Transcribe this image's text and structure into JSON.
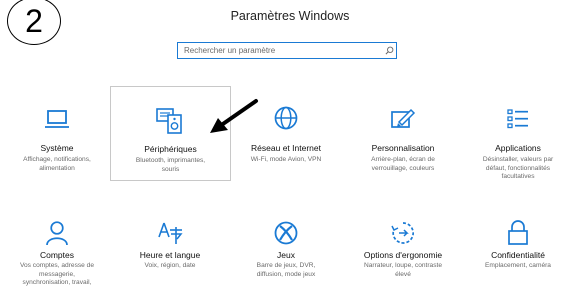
{
  "step_marker": "2",
  "window_title": "Paramètres Windows",
  "search": {
    "placeholder": "Rechercher un paramètre"
  },
  "accent_color": "#1a7ad4",
  "tiles_row1": [
    {
      "id": "systeme",
      "icon": "laptop-icon",
      "name": "Système",
      "description": "Affichage, notifications,\nalimentation"
    },
    {
      "id": "peripheriques",
      "icon": "devices-icon",
      "name": "Périphériques",
      "description": "Bluetooth, imprimantes,\nsouris"
    },
    {
      "id": "reseau",
      "icon": "globe-icon",
      "name": "Réseau et Internet",
      "description": "Wi-Fi, mode Avion, VPN"
    },
    {
      "id": "personnalisation",
      "icon": "paint-icon",
      "name": "Personnalisation",
      "description": "Arrière-plan, écran de\nverrouillage, couleurs"
    },
    {
      "id": "applications",
      "icon": "apps-list-icon",
      "name": "Applications",
      "description": "Désinstaller, valeurs par\ndéfaut, fonctionnalités\nfacultatives"
    }
  ],
  "tiles_row2": [
    {
      "id": "comptes",
      "icon": "person-icon",
      "name": "Comptes",
      "description": "Vos comptes, adresse de\nmessagerie,\nsynchronisation, travail,"
    },
    {
      "id": "heure",
      "icon": "time-language-icon",
      "name": "Heure et langue",
      "description": "Voix, région, date"
    },
    {
      "id": "jeux",
      "icon": "xbox-icon",
      "name": "Jeux",
      "description": "Barre de jeux, DVR,\ndiffusion, mode jeux"
    },
    {
      "id": "ergonomie",
      "icon": "ease-of-access-icon",
      "name": "Options d'ergonomie",
      "description": "Narrateur, loupe, contraste\nélevé"
    },
    {
      "id": "confidentialite",
      "icon": "lock-icon",
      "name": "Confidentialité",
      "description": "Emplacement, caméra"
    }
  ]
}
